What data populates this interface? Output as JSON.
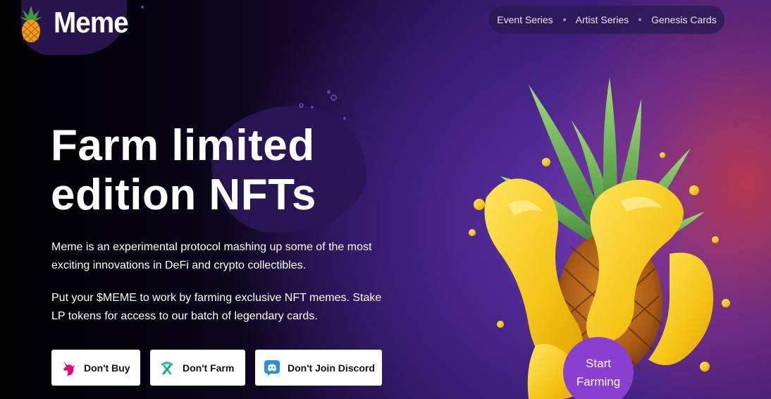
{
  "brand": {
    "name": "Meme"
  },
  "nav": {
    "items": [
      {
        "label": "Event Series"
      },
      {
        "label": "Artist Series"
      },
      {
        "label": "Genesis Cards"
      }
    ]
  },
  "hero": {
    "title_line1": "Farm limited",
    "title_line2": "edition NFTs",
    "paragraph1": "Meme is an experimental protocol mashing up some of the most exciting innovations in DeFi and crypto collectibles.",
    "paragraph2": "Put your $MEME to work by farming exclusive NFT memes. Stake LP tokens for access to our batch of legendary cards."
  },
  "buttons": {
    "buy": {
      "label": "Don't Buy",
      "icon": "unicorn-icon",
      "color": "#e6007a"
    },
    "farm": {
      "label": "Don't Farm",
      "icon": "pickaxe-icon",
      "color": "#27c4a4"
    },
    "discord": {
      "label": "Don't Join Discord",
      "icon": "discord-icon",
      "color": "#2f8ed8"
    }
  },
  "cta": {
    "line1": "Start",
    "line2": "Farming",
    "color": "#8b3fd0"
  },
  "colors": {
    "nav_bg": "#281950",
    "accent_purple": "#8b3fd0",
    "juice_yellow": "#f5c518"
  }
}
